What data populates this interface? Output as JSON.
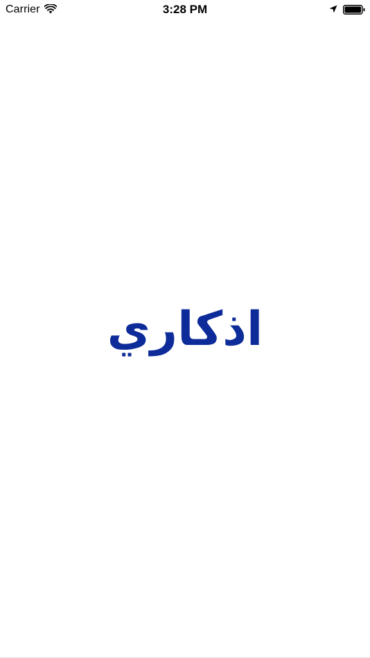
{
  "status_bar": {
    "carrier": "Carrier",
    "time": "3:28 PM",
    "icons": [
      "wifi-icon",
      "location-arrow-icon",
      "battery-icon"
    ]
  },
  "splash": {
    "title": "اذكاري",
    "title_color": "#0d2c9a"
  }
}
